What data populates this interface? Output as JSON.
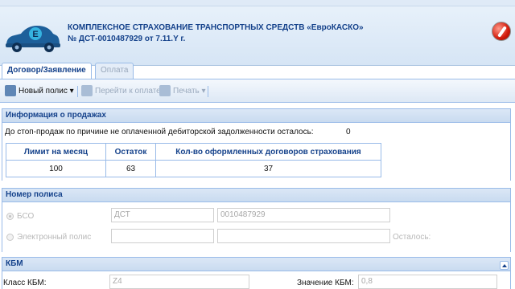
{
  "header": {
    "title": "КОМПЛЕКСНОЕ СТРАХОВАНИЕ ТРАНСПОРТНЫХ СРЕДСТВ «ЕвроКАСКО»",
    "subtitle": "№ ДСТ-0010487929 от 7.11.Y г.",
    "logo_letter": "E"
  },
  "tabs": [
    {
      "label": "Договор/Заявление",
      "active": true
    },
    {
      "label": "Оплата",
      "active": false
    }
  ],
  "toolbar": {
    "new_policy": "Новый полис",
    "go_to_payment": "Перейти к оплате",
    "print": "Печать"
  },
  "sales": {
    "title": "Информация о продажах",
    "stop_text": "До стоп-продаж по причине не оплаченной дебиторской задолженности осталось:",
    "stop_value": "0",
    "columns": [
      "Лимит на месяц",
      "Остаток",
      "Кол-во оформленных договоров страхования"
    ],
    "row": [
      "100",
      "63",
      "37"
    ]
  },
  "policy": {
    "title": "Номер полиса",
    "bso_label": "БСО",
    "bso_series": "ДСТ",
    "bso_number": "0010487929",
    "electronic_label": "Электронный полис",
    "remaining_label": "Осталось:"
  },
  "kbm": {
    "title": "КБМ",
    "class_label": "Класс КБМ:",
    "class_value": "Z4",
    "value_label": "Значение КБМ:",
    "value": "0,8"
  },
  "colors": {
    "accent": "#15428b",
    "border": "#99bbe8",
    "logo": "#1d5f9a"
  }
}
